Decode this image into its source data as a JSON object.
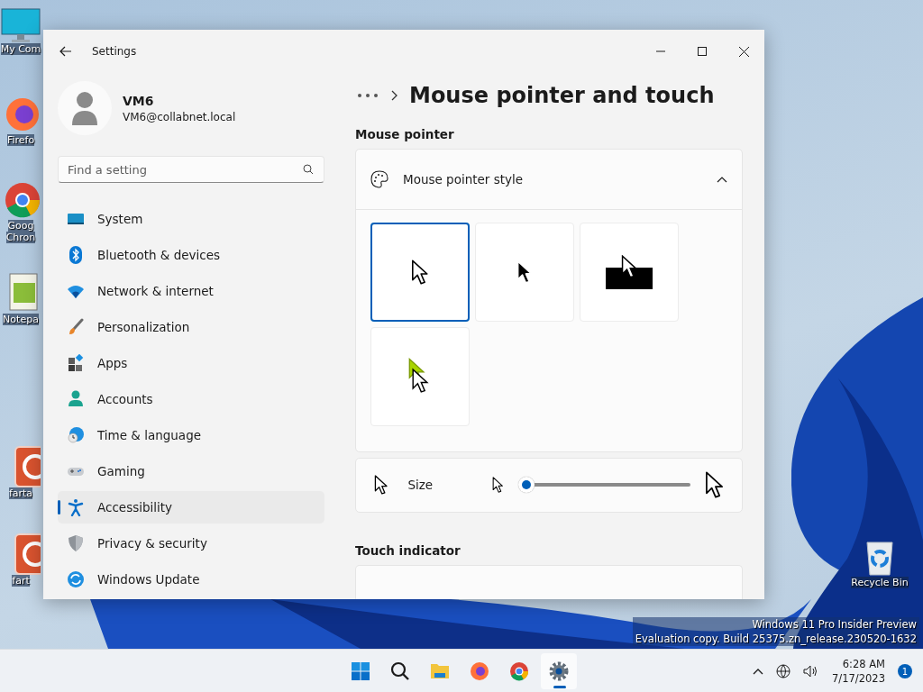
{
  "desktop_icons": [
    {
      "kind": "computer",
      "lines": [
        "My Com"
      ]
    },
    {
      "kind": "firefox",
      "lines": [
        "Firefo"
      ]
    },
    {
      "kind": "chrome",
      "lines": [
        "Goog",
        "Chron"
      ]
    },
    {
      "kind": "notepad",
      "lines": [
        "Notepa"
      ]
    },
    {
      "kind": "power",
      "lines": [
        "farta"
      ]
    },
    {
      "kind": "power",
      "lines": [
        "fart"
      ]
    },
    {
      "kind": "recycle",
      "lines": [
        "Recycle Bin"
      ]
    }
  ],
  "watermark": [
    "Windows 11 Pro Insider Preview",
    "Evaluation copy. Build 25375.zn_release.230520-1632"
  ],
  "window": {
    "title": "Settings"
  },
  "user": {
    "name": "VM6",
    "email": "VM6@collabnet.local"
  },
  "search": {
    "placeholder": "Find a setting"
  },
  "nav": [
    {
      "kind": "system",
      "label": "System",
      "selected": false
    },
    {
      "kind": "bluetooth",
      "label": "Bluetooth & devices",
      "selected": false
    },
    {
      "kind": "network",
      "label": "Network & internet",
      "selected": false
    },
    {
      "kind": "personalization",
      "label": "Personalization",
      "selected": false
    },
    {
      "kind": "apps",
      "label": "Apps",
      "selected": false
    },
    {
      "kind": "accounts",
      "label": "Accounts",
      "selected": false
    },
    {
      "kind": "time",
      "label": "Time & language",
      "selected": false
    },
    {
      "kind": "gaming",
      "label": "Gaming",
      "selected": false
    },
    {
      "kind": "accessibility",
      "label": "Accessibility",
      "selected": true
    },
    {
      "kind": "privacy",
      "label": "Privacy & security",
      "selected": false
    },
    {
      "kind": "update",
      "label": "Windows Update",
      "selected": false
    }
  ],
  "page": {
    "title": "Mouse pointer and touch"
  },
  "mouse_pointer": {
    "heading": "Mouse pointer",
    "style_card": {
      "label": "Mouse pointer style",
      "expanded": true,
      "styles": [
        {
          "kind": "white",
          "selected": true
        },
        {
          "kind": "black",
          "selected": false
        },
        {
          "kind": "inverted",
          "selected": false
        },
        {
          "kind": "custom",
          "selected": false
        }
      ]
    },
    "size": {
      "label": "Size",
      "level": 0
    }
  },
  "touch_indicator": {
    "heading": "Touch indicator"
  },
  "taskbar": {
    "apps": [
      {
        "kind": "start",
        "active": false
      },
      {
        "kind": "search",
        "active": false
      },
      {
        "kind": "explorer",
        "active": false
      },
      {
        "kind": "firefox",
        "active": false
      },
      {
        "kind": "chrome",
        "active": false
      },
      {
        "kind": "settings",
        "active": true
      }
    ],
    "time": "6:28 AM",
    "date": "7/17/2023",
    "notifications": "1"
  }
}
